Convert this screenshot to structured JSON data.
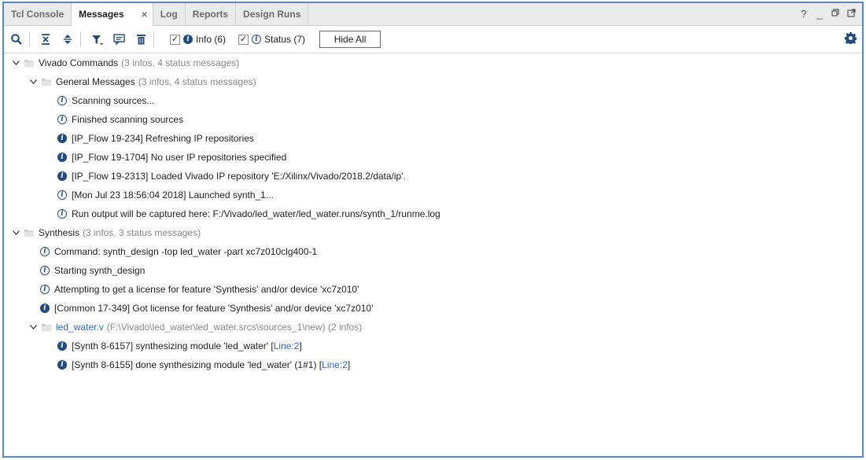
{
  "tabs": [
    {
      "label": "Tcl Console",
      "active": false
    },
    {
      "label": "Messages",
      "active": true
    },
    {
      "label": "Log",
      "active": false
    },
    {
      "label": "Reports",
      "active": false
    },
    {
      "label": "Design Runs",
      "active": false
    }
  ],
  "window_controls": {
    "help": "?",
    "minimize": "_",
    "restore": "▢",
    "float": "⧉"
  },
  "toolbar": {
    "info_checkbox": {
      "checked": true,
      "label": "Info (6)"
    },
    "status_checkbox": {
      "checked": true,
      "label": "Status (7)"
    },
    "hide_all_label": "Hide All",
    "icons": [
      "search-icon",
      "collapse-all-icon",
      "expand-all-icon",
      "filter-icon",
      "comment-icon",
      "delete-icon",
      "settings-icon"
    ]
  },
  "colors": {
    "accent_border": "#5b86c4",
    "info_icon": "#234a7d",
    "link": "#2f65c5",
    "meta_text": "#888888"
  },
  "tree": {
    "vivado_commands": {
      "label": "Vivado Commands",
      "meta": "(3 infos, 4 status messages)",
      "general_messages": {
        "label": "General Messages",
        "meta": "(3 infos, 4 status messages)",
        "messages": [
          {
            "kind": "status",
            "text": "Scanning sources..."
          },
          {
            "kind": "status",
            "text": "Finished scanning sources"
          },
          {
            "kind": "info",
            "text": "[IP_Flow 19-234] Refreshing IP repositories"
          },
          {
            "kind": "info",
            "text": "[IP_Flow 19-1704] No user IP repositories specified"
          },
          {
            "kind": "info",
            "text": "[IP_Flow 19-2313] Loaded Vivado IP repository 'E:/Xilinx/Vivado/2018.2/data/ip'."
          },
          {
            "kind": "status",
            "text": "[Mon Jul 23 18:56:04 2018] Launched synth_1..."
          },
          {
            "kind": "status",
            "text": "Run output will be captured here: F:/Vivado/led_water/led_water.runs/synth_1/runme.log"
          }
        ]
      }
    },
    "synthesis": {
      "label": "Synthesis",
      "meta": "(3 infos, 3 status messages)",
      "messages": [
        {
          "kind": "status",
          "text": "Command: synth_design -top led_water -part xc7z010clg400-1"
        },
        {
          "kind": "status",
          "text": "Starting synth_design"
        },
        {
          "kind": "status",
          "text": "Attempting to get a license for feature 'Synthesis' and/or device 'xc7z010'"
        },
        {
          "kind": "info",
          "text": "[Common 17-349] Got license for feature 'Synthesis' and/or device 'xc7z010'"
        }
      ],
      "file_group": {
        "file": "led_water.v",
        "meta": "(F:\\Vivado\\led_water\\led_water.srcs\\sources_1\\new) (2 infos)",
        "messages": [
          {
            "kind": "info",
            "text": "[Synth 8-6157] synthesizing module 'led_water' [",
            "link": "Line:2",
            "suffix": "]"
          },
          {
            "kind": "info",
            "text": "[Synth 8-6155] done synthesizing module 'led_water' (1#1) [",
            "link": "Line:2",
            "suffix": "]"
          }
        ]
      }
    }
  }
}
